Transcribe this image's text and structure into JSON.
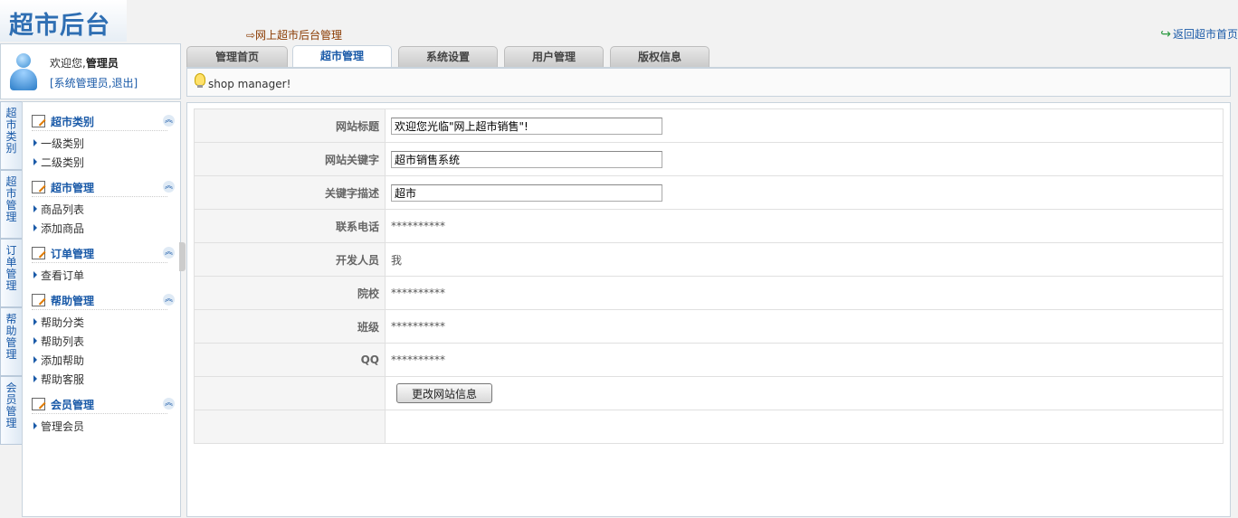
{
  "logo": {
    "text": "超市后台"
  },
  "breadcrumb": {
    "text": "⇨网上超市后台管理"
  },
  "top_link": {
    "text": "返回超市首页"
  },
  "user": {
    "welcome": "欢迎您,",
    "name": "管理员",
    "links": "[系统管理员,退出]"
  },
  "tabs": [
    {
      "label": "管理首页"
    },
    {
      "label": "超市管理"
    },
    {
      "label": "系统设置"
    },
    {
      "label": "用户管理"
    },
    {
      "label": "版权信息"
    }
  ],
  "subbar": {
    "text": "shop manager!"
  },
  "vtabs": [
    {
      "label": "超市类别"
    },
    {
      "label": "超市管理"
    },
    {
      "label": "订单管理"
    },
    {
      "label": "帮助管理"
    },
    {
      "label": "会员管理"
    }
  ],
  "menu": {
    "groups": [
      {
        "title": "超市类别",
        "items": [
          "一级类别",
          "二级类别"
        ]
      },
      {
        "title": "超市管理",
        "items": [
          "商品列表",
          "添加商品"
        ]
      },
      {
        "title": "订单管理",
        "items": [
          "查看订单"
        ]
      },
      {
        "title": "帮助管理",
        "items": [
          "帮助分类",
          "帮助列表",
          "添加帮助",
          "帮助客服"
        ]
      },
      {
        "title": "会员管理",
        "items": [
          "管理会员"
        ]
      }
    ]
  },
  "form": {
    "rows": [
      {
        "label": "网站标题",
        "value": "欢迎您光临\"网上超市销售\"!"
      },
      {
        "label": "网站关键字",
        "value": "超市销售系统"
      },
      {
        "label": "关键字描述",
        "value": "超市"
      },
      {
        "label": "联系电话",
        "value": "**********"
      },
      {
        "label": "开发人员",
        "value": "我"
      },
      {
        "label": "院校",
        "value": "**********"
      },
      {
        "label": "班级",
        "value": "**********"
      },
      {
        "label": "QQ",
        "value": "**********"
      }
    ],
    "submit_label": "更改网站信息"
  },
  "colors": {
    "accent": "#1a5aa8",
    "logo": "#2f6fb3",
    "border": "#c8d3dd"
  },
  "icons": {
    "back": "arrow-icon",
    "tip": "bulb-icon",
    "avatar": "user-avatar-icon"
  }
}
